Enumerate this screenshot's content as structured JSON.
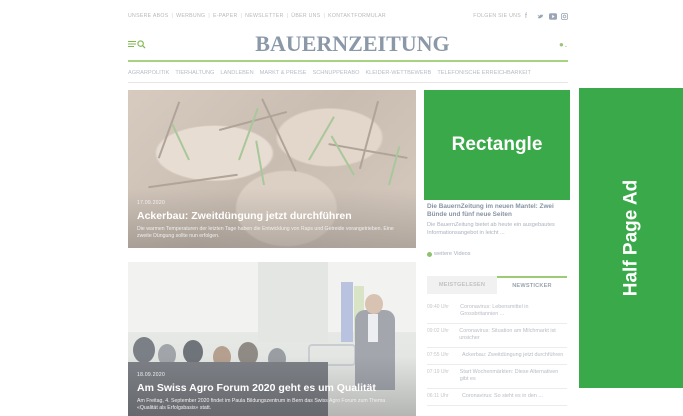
{
  "top": {
    "links": [
      "UNSERE ABOS",
      "WERBUNG",
      "E-PAPER",
      "NEWSLETTER",
      "ÜBER UNS",
      "KONTAKTFORMULAR"
    ],
    "follow_label": "FOLGEN SIE UNS",
    "social_icons": [
      "facebook-icon",
      "twitter-icon",
      "youtube-icon",
      "instagram-icon"
    ]
  },
  "header": {
    "logo": "BAUERNZEITUNG"
  },
  "nav": {
    "items": [
      "AGRARPOLITIK",
      "TIERHALTUNG",
      "LANDLEBEN",
      "MARKT & PREISE",
      "SCHNUPPERABO",
      "KLEIDER-WETTBEWERB",
      "TELEFONISCHE ERREICHBARKEIT"
    ]
  },
  "articles": [
    {
      "date": "17.09.2020",
      "title": "Ackerbau: Zweitdüngung jetzt durchführen",
      "lead": "Die warmen Temperaturen der letzten Tage haben die Entwicklung von Raps und Getreide vorangetrieben. Eine zweite Düngung sollte nun erfolgen."
    },
    {
      "date": "18.09.2020",
      "title": "Am Swiss Agro Forum 2020 geht es um Qualität",
      "lead": "Am Freitag, 4. September 2020 findet im Paula Bildungszentrum in Bern das Swiss Agro Forum zum Thema «Qualität als Erfolgsbasis» statt."
    }
  ],
  "ads": {
    "rectangle": "Rectangle",
    "half_page": "Half Page Ad"
  },
  "video": {
    "title": "Die BauernZeitung im neuen Mantel: Zwei Bünde und fünf neue Seiten",
    "text": "Die BauernZeitung bietet ab heute ein ausgebautes Informationsangebot in leicht ...",
    "more": "weitere Videos"
  },
  "tabs": {
    "most_read": "MEISTGELESEN",
    "newsticker": "NEWSTICKER"
  },
  "ticker": [
    {
      "time": "09:40 Uhr",
      "text": "Coronavirus: Lebensmittel in Grossbritannien ..."
    },
    {
      "time": "09:02 Uhr",
      "text": "Coronavirus: Situation am Milchmarkt ist unsicher"
    },
    {
      "time": "07:55 Uhr",
      "text": "Ackerbau: Zweitdüngung jetzt durchführen"
    },
    {
      "time": "07:19 Uhr",
      "text": "Start Wochenmärkten: Diese Alternativen gibt es"
    },
    {
      "time": "06:11 Uhr",
      "text": "Coronavirus: So sieht es in den ..."
    }
  ]
}
